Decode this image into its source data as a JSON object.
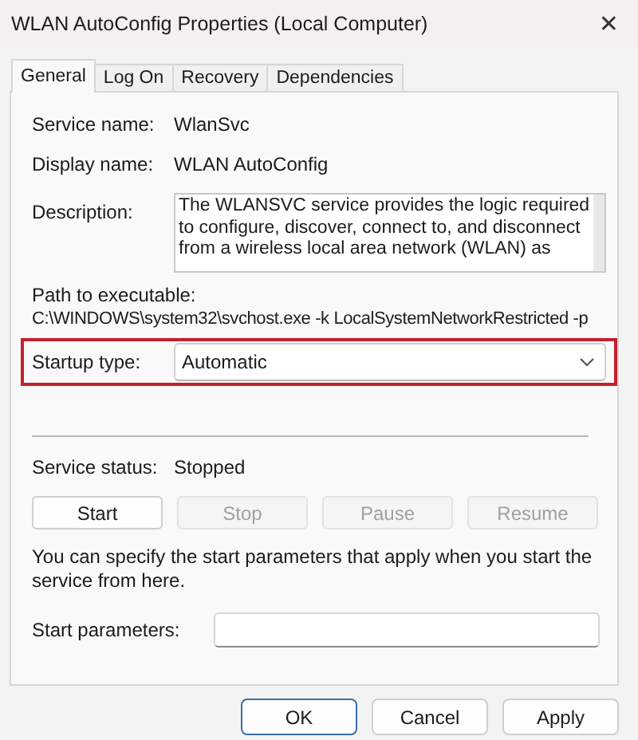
{
  "window": {
    "title": "WLAN AutoConfig Properties (Local Computer)",
    "close": "✕"
  },
  "tabs": [
    {
      "label": "General",
      "selected": true
    },
    {
      "label": "Log On",
      "selected": false
    },
    {
      "label": "Recovery",
      "selected": false
    },
    {
      "label": "Dependencies",
      "selected": false
    }
  ],
  "service_name": {
    "label": "Service name:",
    "value": "WlanSvc"
  },
  "display_name": {
    "label": "Display name:",
    "value": "WLAN AutoConfig"
  },
  "description": {
    "label": "Description:",
    "lines": [
      "The WLANSVC service provides the logic required",
      "to configure, discover, connect to, and disconnect",
      "from a wireless local area network (WLAN) as"
    ]
  },
  "path": {
    "label": "Path to executable:",
    "value": "C:\\WINDOWS\\system32\\svchost.exe -k LocalSystemNetworkRestricted -p"
  },
  "startup_type": {
    "label": "Startup type:",
    "value": "Automatic",
    "highlighted": true
  },
  "service_status": {
    "label": "Service status:",
    "value": "Stopped"
  },
  "control_buttons": [
    {
      "label": "Start",
      "disabled": false
    },
    {
      "label": "Stop",
      "disabled": true
    },
    {
      "label": "Pause",
      "disabled": true
    },
    {
      "label": "Resume",
      "disabled": true
    }
  ],
  "hint": "You can specify the start parameters that apply when you start the service from here.",
  "start_parameters": {
    "label": "Start parameters:"
  },
  "dialog_buttons": [
    {
      "label": "OK",
      "default": true
    },
    {
      "label": "Cancel",
      "default": false
    },
    {
      "label": "Apply",
      "default": false
    }
  ]
}
